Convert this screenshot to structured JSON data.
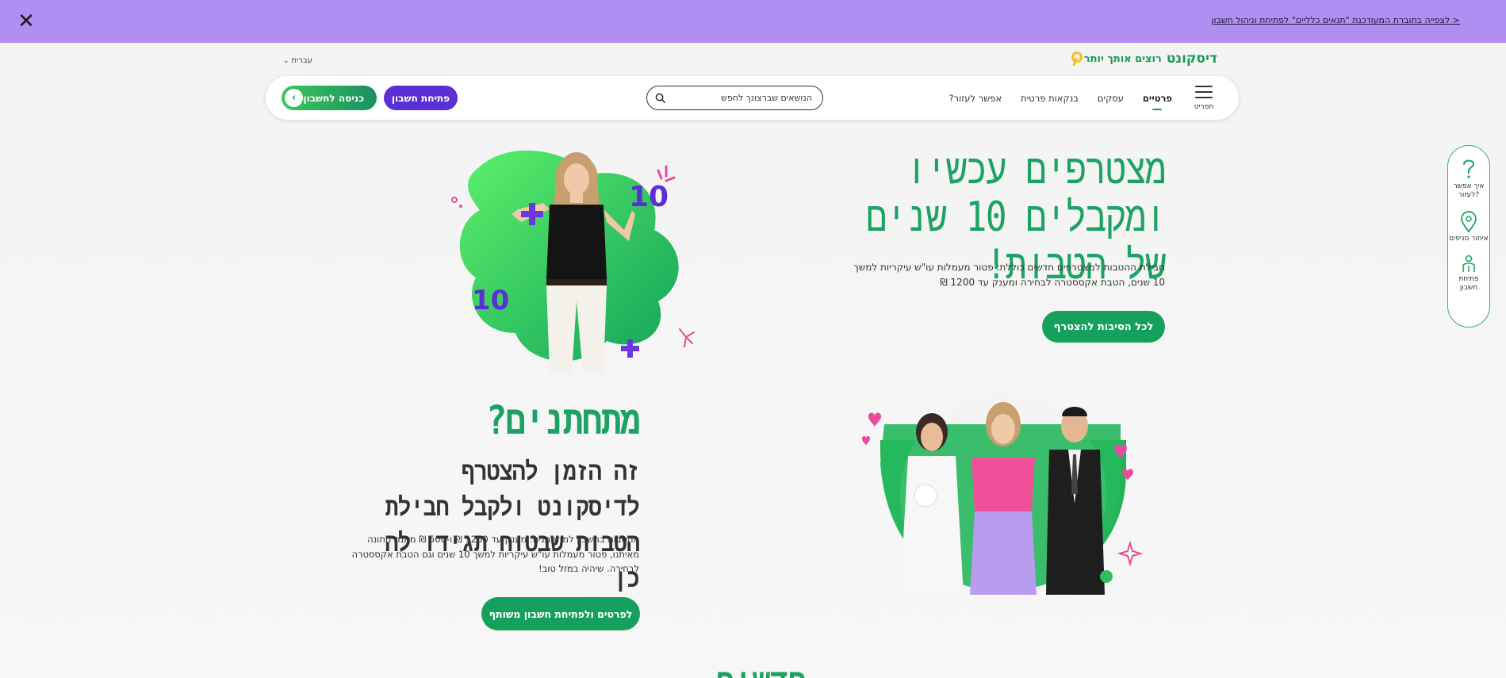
{
  "promo_bar": {
    "link_text": "< לצפייה בחוברת המעודכנת \"תנאים כלליים\" לפתיחת וניהול חשבון",
    "close_label": "✕",
    "background": "#b18ef2"
  },
  "language": {
    "label": "עברית"
  },
  "logo": {
    "brand": "דיסקונט",
    "slogan": "רוצים אותך יותר"
  },
  "nav": {
    "login_button": "כניסה לחשבון",
    "open_account_button": "פתיחת חשבון",
    "search_placeholder": "הנושאים שברצונך לחפש",
    "links": [
      {
        "label": "פרטיים",
        "active": true
      },
      {
        "label": "עסקים",
        "active": false
      },
      {
        "label": "בנקאות פרטית",
        "active": false
      },
      {
        "label": "אפשר לעזור?",
        "active": false
      }
    ],
    "menu_label": "תפריט"
  },
  "side_widget": {
    "items": [
      {
        "label": "איך אפשר לעזור?",
        "icon": "question-icon"
      },
      {
        "label": "איתור סניפים",
        "icon": "location-pin-icon"
      },
      {
        "label": "פתיחת חשבון",
        "icon": "person-icon"
      }
    ]
  },
  "hero": {
    "title": "מצטרפים עכשיו ומקבלים 10 שנים של הטבות!",
    "description": "חבילת ההטבות למצטרפים חדשים כוללת: פטור מעמלות עו\"ש עיקריות למשך 10 שנים, הטבת אקססטרה לבחירה ומענק עד 1200 ₪",
    "cta": "לכל הסיבות להצטרף"
  },
  "newlyweds": {
    "title": "מתחתנים?",
    "subtitle": "זה הזמן להצטרף לדיסקונט ולקבל חבילת הטבות שבטוח תגידו לה כן",
    "description": "ההטבות בחשבון למתחתנים: מענק עד 1200 ₪ ו-500 ₪ מתנת חתונה מאיתנו, פטור מעמלות עו\"ש עיקריות למשך 10 שנים וגם הטבת אקססטרה לבחירה. שיהיה במזל טוב!",
    "cta": "לפרטים ולפתיחת חשבון משותף"
  },
  "next_section": {
    "title": "חדשים בדיסקונט"
  },
  "colors": {
    "brand_green": "#1aa362",
    "brand_purple": "#5b2fd3",
    "promo": "#b18ef2"
  }
}
